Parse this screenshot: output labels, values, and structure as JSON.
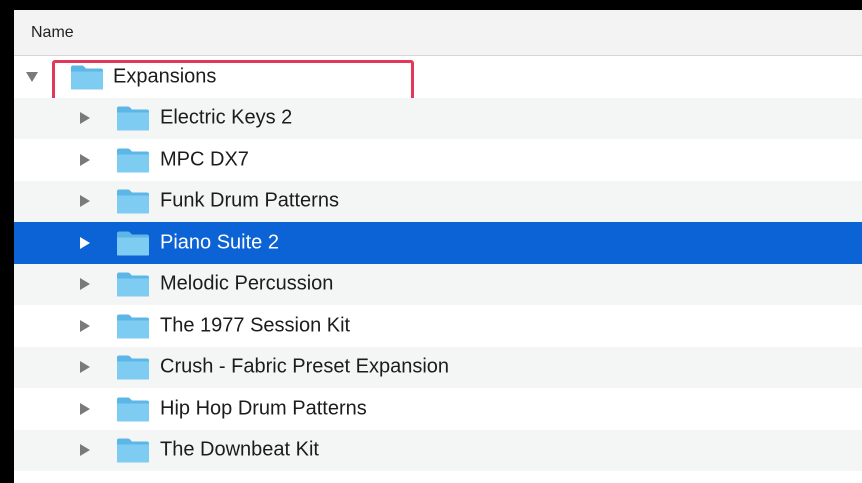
{
  "header": {
    "name_column": "Name"
  },
  "parent_folder": {
    "label": "Expansions",
    "expanded": true,
    "icon": "folder-icon",
    "highlighted": true
  },
  "children": [
    {
      "label": "Electric Keys 2",
      "icon": "folder-icon",
      "selected": false
    },
    {
      "label": "MPC DX7",
      "icon": "folder-icon",
      "selected": false
    },
    {
      "label": "Funk Drum Patterns",
      "icon": "folder-icon",
      "selected": false
    },
    {
      "label": "Piano Suite 2",
      "icon": "folder-icon",
      "selected": true
    },
    {
      "label": "Melodic Percussion",
      "icon": "folder-icon",
      "selected": false
    },
    {
      "label": "The 1977 Session Kit",
      "icon": "folder-icon",
      "selected": false
    },
    {
      "label": "Crush - Fabric Preset Expansion",
      "icon": "folder-icon",
      "selected": false
    },
    {
      "label": "Hip Hop Drum Patterns",
      "icon": "folder-icon",
      "selected": false
    },
    {
      "label": "The Downbeat Kit",
      "icon": "folder-icon",
      "selected": false
    }
  ],
  "colors": {
    "selection": "#0b63d6",
    "highlight_box": "#e5375a",
    "folder_fill": "#6fc3ee"
  }
}
